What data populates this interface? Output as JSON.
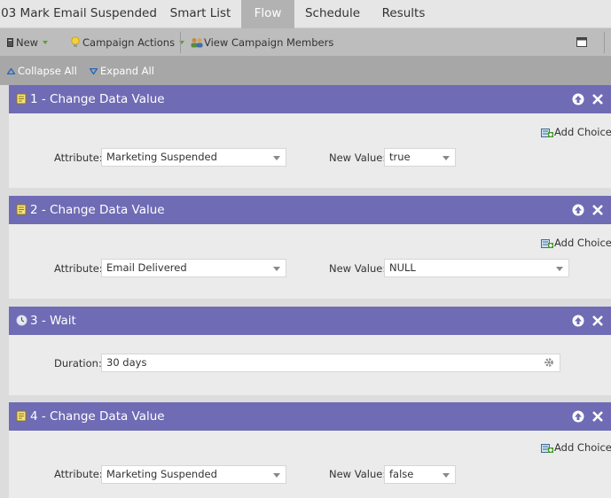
{
  "tabs": [
    {
      "label": "03 Mark Email Suspended"
    },
    {
      "label": "Smart List"
    },
    {
      "label": "Flow",
      "active": true
    },
    {
      "label": "Schedule"
    },
    {
      "label": "Results"
    }
  ],
  "toolbar": {
    "new_label": "New",
    "campaign_actions_label": "Campaign Actions",
    "view_members_label": "View Campaign Members"
  },
  "collapse_bar": {
    "collapse_label": "Collapse All",
    "expand_label": "Expand All"
  },
  "steps": [
    {
      "title": "1 - Change Data Value",
      "icon": "data-value-icon",
      "add_choice": "Add Choice",
      "attribute_label": "Attribute:",
      "attribute_value": "Marketing Suspended",
      "new_value_label": "New Value:",
      "new_value": "true"
    },
    {
      "title": "2 - Change Data Value",
      "icon": "data-value-icon",
      "add_choice": "Add Choice",
      "attribute_label": "Attribute:",
      "attribute_value": "Email Delivered",
      "new_value_label": "New Value:",
      "new_value": "NULL"
    },
    {
      "title": "3 - Wait",
      "icon": "clock-icon",
      "duration_label": "Duration:",
      "duration_value": "30 days"
    },
    {
      "title": "4 - Change Data Value",
      "icon": "data-value-icon",
      "add_choice": "Add Choice",
      "attribute_label": "Attribute:",
      "attribute_value": "Marketing Suspended",
      "new_value_label": "New Value:",
      "new_value": "false"
    }
  ],
  "colors": {
    "step_header": "#6f6bb4",
    "active_tab": "#b2b2b2",
    "toolbar": "#bdbdbd"
  }
}
